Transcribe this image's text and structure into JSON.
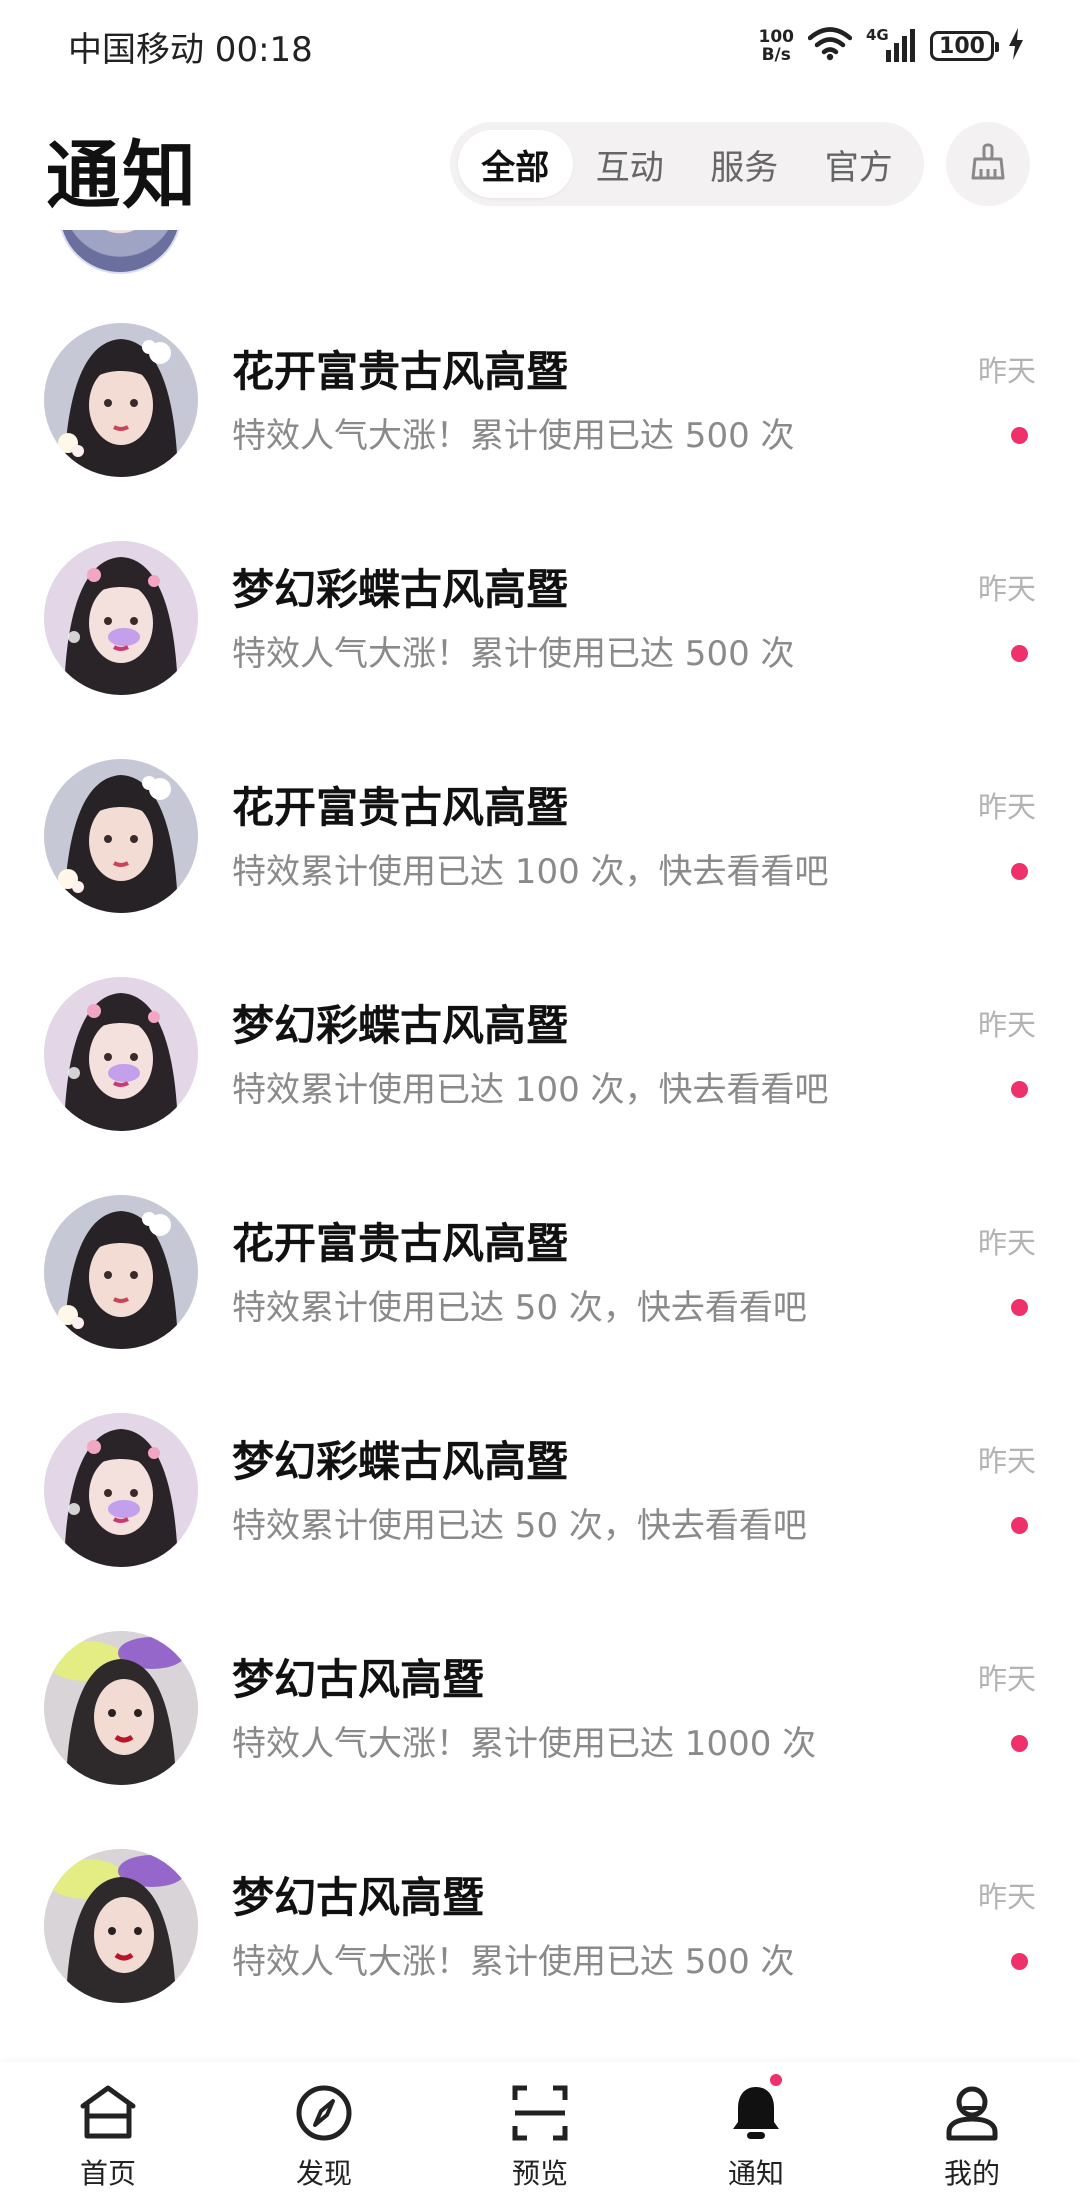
{
  "status_bar": {
    "carrier_time": "中国移动 00:18",
    "net_speed_top": "100",
    "net_speed_bottom": "B/s",
    "network_type": "4G",
    "battery": "100"
  },
  "header": {
    "title": "通知",
    "tabs": [
      "全部",
      "互动",
      "服务",
      "官方"
    ],
    "active_tab": "全部",
    "clear_icon": "broom-icon"
  },
  "notifications": [
    {
      "title": "花开富贵古风高暨",
      "desc": "特效人气大涨！累计使用已达 500 次",
      "time": "昨天",
      "unread": true,
      "avatar": "flower"
    },
    {
      "title": "梦幻彩蝶古风高暨",
      "desc": "特效人气大涨！累计使用已达 500 次",
      "time": "昨天",
      "unread": true,
      "avatar": "butterfly"
    },
    {
      "title": "花开富贵古风高暨",
      "desc": "特效累计使用已达 100 次，快去看看吧",
      "time": "昨天",
      "unread": true,
      "avatar": "flower"
    },
    {
      "title": "梦幻彩蝶古风高暨",
      "desc": "特效累计使用已达 100 次，快去看看吧",
      "time": "昨天",
      "unread": true,
      "avatar": "butterfly"
    },
    {
      "title": "花开富贵古风高暨",
      "desc": "特效累计使用已达 50 次，快去看看吧",
      "time": "昨天",
      "unread": true,
      "avatar": "flower"
    },
    {
      "title": "梦幻彩蝶古风高暨",
      "desc": "特效累计使用已达 50 次，快去看看吧",
      "time": "昨天",
      "unread": true,
      "avatar": "butterfly"
    },
    {
      "title": "梦幻古风高暨",
      "desc": "特效人气大涨！累计使用已达 1000 次",
      "time": "昨天",
      "unread": true,
      "avatar": "fantasy"
    },
    {
      "title": "梦幻古风高暨",
      "desc": "特效人气大涨！累计使用已达 500 次",
      "time": "昨天",
      "unread": true,
      "avatar": "fantasy"
    }
  ],
  "bottom_nav": [
    {
      "label": "首页",
      "icon": "home-icon",
      "active": false
    },
    {
      "label": "发现",
      "icon": "compass-icon",
      "active": false
    },
    {
      "label": "预览",
      "icon": "scan-icon",
      "active": false
    },
    {
      "label": "通知",
      "icon": "bell-icon",
      "active": true,
      "badge": true
    },
    {
      "label": "我的",
      "icon": "profile-icon",
      "active": false
    }
  ],
  "colors": {
    "accent": "#f0306b",
    "tab_bg": "#f3f1f2",
    "muted_text": "#8a8a8a",
    "time_text": "#b3b3b3"
  }
}
